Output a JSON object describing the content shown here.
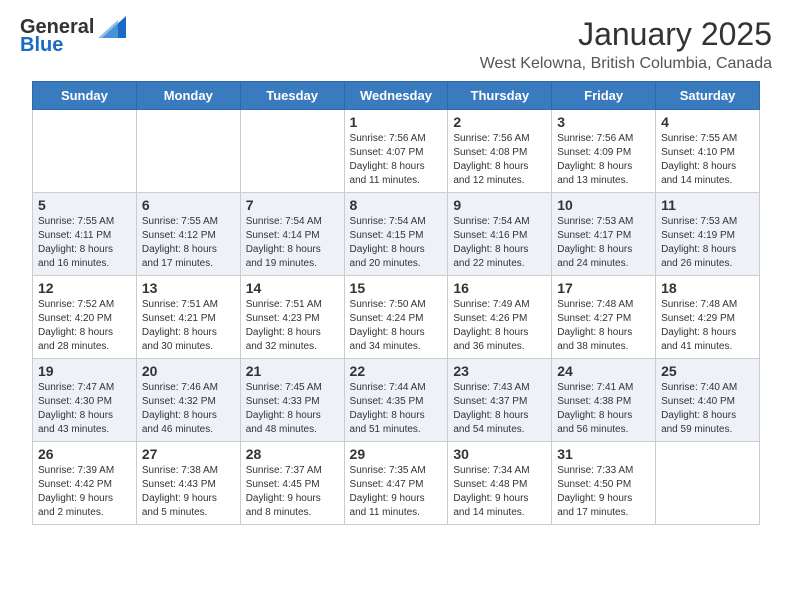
{
  "header": {
    "logo_general": "General",
    "logo_blue": "Blue",
    "main_title": "January 2025",
    "subtitle": "West Kelowna, British Columbia, Canada"
  },
  "days_of_week": [
    "Sunday",
    "Monday",
    "Tuesday",
    "Wednesday",
    "Thursday",
    "Friday",
    "Saturday"
  ],
  "weeks": [
    {
      "row_alt": false,
      "days": [
        {
          "num": "",
          "info": ""
        },
        {
          "num": "",
          "info": ""
        },
        {
          "num": "",
          "info": ""
        },
        {
          "num": "1",
          "info": "Sunrise: 7:56 AM\nSunset: 4:07 PM\nDaylight: 8 hours\nand 11 minutes."
        },
        {
          "num": "2",
          "info": "Sunrise: 7:56 AM\nSunset: 4:08 PM\nDaylight: 8 hours\nand 12 minutes."
        },
        {
          "num": "3",
          "info": "Sunrise: 7:56 AM\nSunset: 4:09 PM\nDaylight: 8 hours\nand 13 minutes."
        },
        {
          "num": "4",
          "info": "Sunrise: 7:55 AM\nSunset: 4:10 PM\nDaylight: 8 hours\nand 14 minutes."
        }
      ]
    },
    {
      "row_alt": true,
      "days": [
        {
          "num": "5",
          "info": "Sunrise: 7:55 AM\nSunset: 4:11 PM\nDaylight: 8 hours\nand 16 minutes."
        },
        {
          "num": "6",
          "info": "Sunrise: 7:55 AM\nSunset: 4:12 PM\nDaylight: 8 hours\nand 17 minutes."
        },
        {
          "num": "7",
          "info": "Sunrise: 7:54 AM\nSunset: 4:14 PM\nDaylight: 8 hours\nand 19 minutes."
        },
        {
          "num": "8",
          "info": "Sunrise: 7:54 AM\nSunset: 4:15 PM\nDaylight: 8 hours\nand 20 minutes."
        },
        {
          "num": "9",
          "info": "Sunrise: 7:54 AM\nSunset: 4:16 PM\nDaylight: 8 hours\nand 22 minutes."
        },
        {
          "num": "10",
          "info": "Sunrise: 7:53 AM\nSunset: 4:17 PM\nDaylight: 8 hours\nand 24 minutes."
        },
        {
          "num": "11",
          "info": "Sunrise: 7:53 AM\nSunset: 4:19 PM\nDaylight: 8 hours\nand 26 minutes."
        }
      ]
    },
    {
      "row_alt": false,
      "days": [
        {
          "num": "12",
          "info": "Sunrise: 7:52 AM\nSunset: 4:20 PM\nDaylight: 8 hours\nand 28 minutes."
        },
        {
          "num": "13",
          "info": "Sunrise: 7:51 AM\nSunset: 4:21 PM\nDaylight: 8 hours\nand 30 minutes."
        },
        {
          "num": "14",
          "info": "Sunrise: 7:51 AM\nSunset: 4:23 PM\nDaylight: 8 hours\nand 32 minutes."
        },
        {
          "num": "15",
          "info": "Sunrise: 7:50 AM\nSunset: 4:24 PM\nDaylight: 8 hours\nand 34 minutes."
        },
        {
          "num": "16",
          "info": "Sunrise: 7:49 AM\nSunset: 4:26 PM\nDaylight: 8 hours\nand 36 minutes."
        },
        {
          "num": "17",
          "info": "Sunrise: 7:48 AM\nSunset: 4:27 PM\nDaylight: 8 hours\nand 38 minutes."
        },
        {
          "num": "18",
          "info": "Sunrise: 7:48 AM\nSunset: 4:29 PM\nDaylight: 8 hours\nand 41 minutes."
        }
      ]
    },
    {
      "row_alt": true,
      "days": [
        {
          "num": "19",
          "info": "Sunrise: 7:47 AM\nSunset: 4:30 PM\nDaylight: 8 hours\nand 43 minutes."
        },
        {
          "num": "20",
          "info": "Sunrise: 7:46 AM\nSunset: 4:32 PM\nDaylight: 8 hours\nand 46 minutes."
        },
        {
          "num": "21",
          "info": "Sunrise: 7:45 AM\nSunset: 4:33 PM\nDaylight: 8 hours\nand 48 minutes."
        },
        {
          "num": "22",
          "info": "Sunrise: 7:44 AM\nSunset: 4:35 PM\nDaylight: 8 hours\nand 51 minutes."
        },
        {
          "num": "23",
          "info": "Sunrise: 7:43 AM\nSunset: 4:37 PM\nDaylight: 8 hours\nand 54 minutes."
        },
        {
          "num": "24",
          "info": "Sunrise: 7:41 AM\nSunset: 4:38 PM\nDaylight: 8 hours\nand 56 minutes."
        },
        {
          "num": "25",
          "info": "Sunrise: 7:40 AM\nSunset: 4:40 PM\nDaylight: 8 hours\nand 59 minutes."
        }
      ]
    },
    {
      "row_alt": false,
      "days": [
        {
          "num": "26",
          "info": "Sunrise: 7:39 AM\nSunset: 4:42 PM\nDaylight: 9 hours\nand 2 minutes."
        },
        {
          "num": "27",
          "info": "Sunrise: 7:38 AM\nSunset: 4:43 PM\nDaylight: 9 hours\nand 5 minutes."
        },
        {
          "num": "28",
          "info": "Sunrise: 7:37 AM\nSunset: 4:45 PM\nDaylight: 9 hours\nand 8 minutes."
        },
        {
          "num": "29",
          "info": "Sunrise: 7:35 AM\nSunset: 4:47 PM\nDaylight: 9 hours\nand 11 minutes."
        },
        {
          "num": "30",
          "info": "Sunrise: 7:34 AM\nSunset: 4:48 PM\nDaylight: 9 hours\nand 14 minutes."
        },
        {
          "num": "31",
          "info": "Sunrise: 7:33 AM\nSunset: 4:50 PM\nDaylight: 9 hours\nand 17 minutes."
        },
        {
          "num": "",
          "info": ""
        }
      ]
    }
  ]
}
